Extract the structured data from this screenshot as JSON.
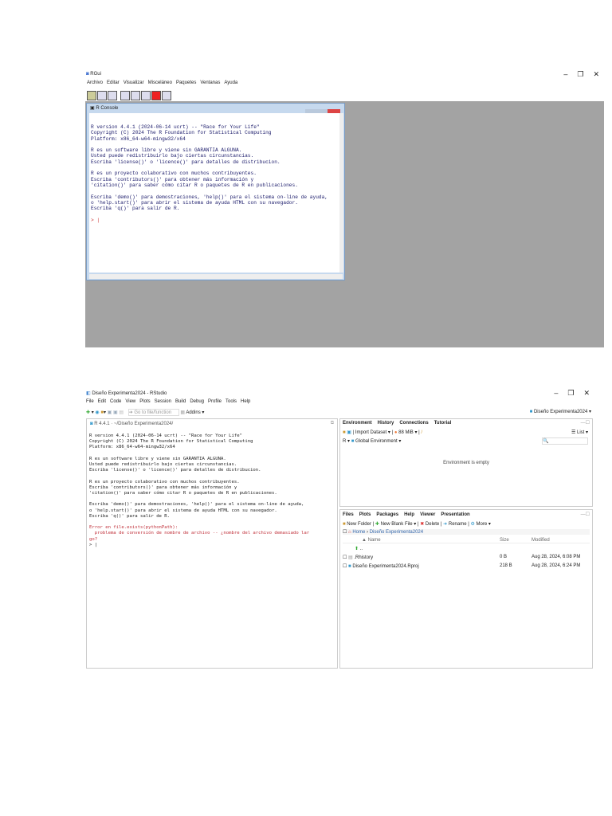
{
  "rgui": {
    "title": "RGui",
    "menu": [
      "Archivo",
      "Editar",
      "Visualizar",
      "Misceláneo",
      "Paquetes",
      "Ventanas",
      "Ayuda"
    ],
    "window_controls": [
      "–",
      "❐",
      "✕"
    ],
    "console_title": "R Console",
    "console_lines": [
      "R version 4.4.1 (2024-06-14 ucrt) -- \"Race for Your Life\"",
      "Copyright (C) 2024 The R Foundation for Statistical Computing",
      "Platform: x86_64-w64-mingw32/x64",
      "",
      "R es un software libre y viene sin GARANTIA ALGUNA.",
      "Usted puede redistribuirlo bajo ciertas circunstancias.",
      "Escriba 'license()' o 'licence()' para detalles de distribucion.",
      "",
      "R es un proyecto colaborativo con muchos contribuyentes.",
      "Escriba 'contributors()' para obtener más información y",
      "'citation()' para saber cómo citar R o paquetes de R en publicaciones.",
      "",
      "Escriba 'demo()' para demostraciones, 'help()' para el sistema on-line de ayuda,",
      "o 'help.start()' para abrir el sistema de ayuda HTML con su navegador.",
      "Escriba 'q()' para salir de R.",
      ""
    ],
    "prompt": ">"
  },
  "rstudio": {
    "title": "Diseño Experimenta2024 - RStudio",
    "menu": [
      "File",
      "Edit",
      "Code",
      "View",
      "Plots",
      "Session",
      "Build",
      "Debug",
      "Profile",
      "Tools",
      "Help"
    ],
    "window_controls": [
      "–",
      "❐",
      "✕"
    ],
    "goto_placeholder": "Go to file/function",
    "addins": "Addins ▾",
    "project": "Diseño Experimenta2024 ▾",
    "console_header": "R 4.4.1 · ~/Diseño Experimenta2024/",
    "console_lines": [
      "R version 4.4.1 (2024-06-14 ucrt) -- \"Race for Your Life\"",
      "Copyright (C) 2024 The R Foundation for Statistical Computing",
      "Platform: x86_64-w64-mingw32/x64",
      "",
      "R es un software libre y viene sin GARANTIA ALGUNA.",
      "Usted puede redistribuirlo bajo ciertas circunstancias.",
      "Escriba 'license()' o 'licence()' para detalles de distribucion.",
      "",
      "R es un proyecto colaborativo con muchos contribuyentes.",
      "Escriba 'contributors()' para obtener más información y",
      "'citation()' para saber cómo citar R o paquetes de R en publicaciones.",
      "",
      "Escriba 'demo()' para demostraciones, 'help()' para el sistema on-line de ayuda,",
      "o 'help.start()' para abrir el sistema de ayuda HTML con su navegador.",
      "Escriba 'q()' para salir de R.",
      ""
    ],
    "error_lines": [
      "Error en file.exists(pythonPath):",
      "  problema de conversión de nombre de archivo -- ¿nombre del archivo demasiado lar",
      "go?"
    ],
    "prompt": ">",
    "env_tabs": [
      "Environment",
      "History",
      "Connections",
      "Tutorial"
    ],
    "env_toolbar": {
      "import": "Import Dataset ▾",
      "memory": "88 MiB ▾",
      "list": "☰ List ▾",
      "r": "R ▾",
      "global": "Global Environment ▾"
    },
    "env_empty": "Environment is empty",
    "files_tabs": [
      "Files",
      "Plots",
      "Packages",
      "Help",
      "Viewer",
      "Presentation"
    ],
    "files_toolbar": {
      "new_folder": "New Folder",
      "new_file": "New Blank File ▾",
      "delete": "Delete",
      "rename": "Rename",
      "more": "More ▾"
    },
    "breadcrumb": [
      "Home",
      "Diseño Experimenta2024"
    ],
    "columns": [
      "▲ Name",
      "Size",
      "Modified"
    ],
    "up": "..",
    "files": [
      {
        "name": ".Rhistory",
        "size": "0 B",
        "modified": "Aug 28, 2024, 6:08 PM"
      },
      {
        "name": "Diseño Experimenta2024.Rproj",
        "size": "218 B",
        "modified": "Aug 28, 2024, 6:24 PM"
      }
    ]
  }
}
